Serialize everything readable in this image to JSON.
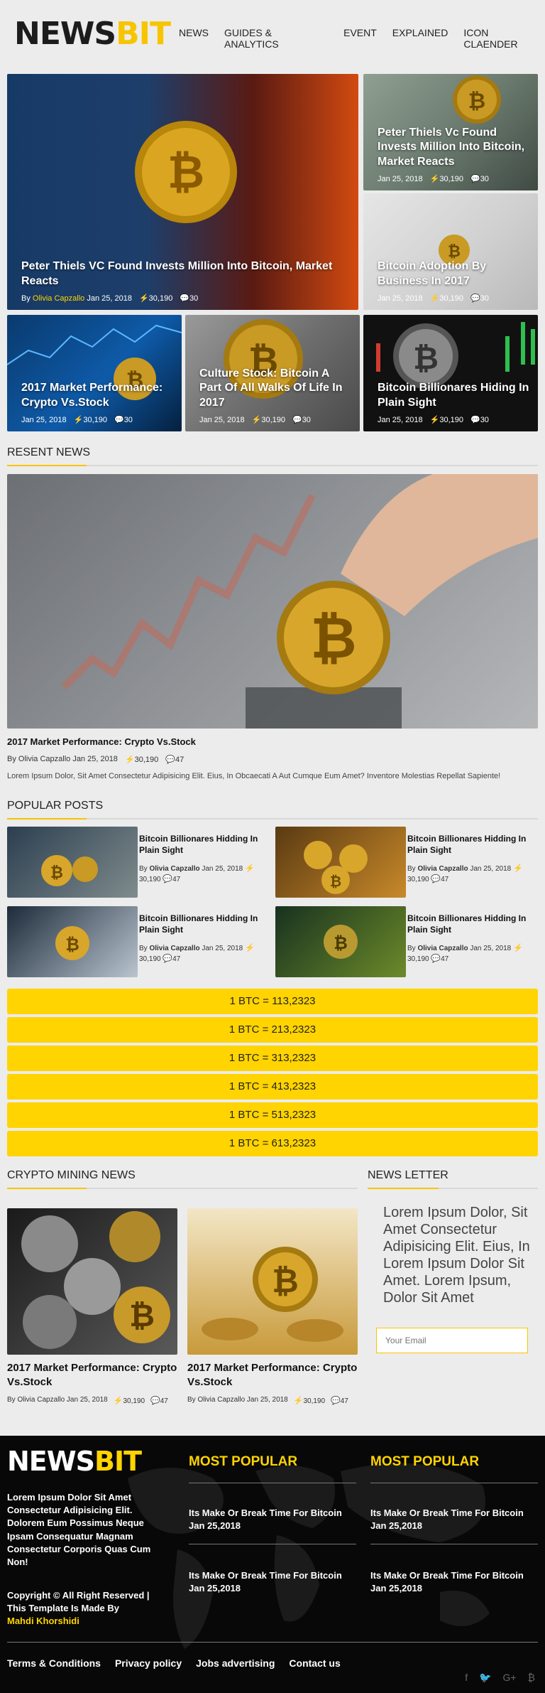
{
  "header": {
    "logo_a": "NEWS",
    "logo_b": "BIT",
    "nav": [
      "NEWS",
      "GUIDES & ANALYTICS",
      "EVENT",
      "EXPLAINED",
      "ICON CLAENDER"
    ]
  },
  "hero": {
    "main": {
      "title": "Peter Thiels VC Found Invests Million Into Bitcoin, Market Reacts",
      "by": "By",
      "author": "Olivia Capzallo",
      "date": "Jan 25, 2018",
      "views": "30,190",
      "comments": "30"
    },
    "side1": {
      "title": "Peter Thiels Vc Found Invests Million Into Bitcoin, Market Reacts",
      "date": "Jan 25, 2018",
      "views": "30,190",
      "comments": "30"
    },
    "side2": {
      "title": "Bitcoin Adoption By Business In 2017",
      "date": "Jan 25, 2018",
      "views": "30,190",
      "comments": "30"
    },
    "bottom1": {
      "title": "2017 Market Performance: Crypto Vs.Stock",
      "date": "Jan 25, 2018",
      "views": "30,190",
      "comments": "30"
    },
    "bottom2": {
      "title": "Culture Stock: Bitcoin A Part Of All Walks Of Life In 2017",
      "date": "Jan 25, 2018",
      "views": "30,190",
      "comments": "30"
    },
    "bottom3": {
      "title": "Bitcoin Billionares Hiding In Plain Sight",
      "date": "Jan 25, 2018",
      "views": "30,190",
      "comments": "30"
    }
  },
  "recent": {
    "heading": "RESENT NEWS",
    "title": "2017 Market Performance: Crypto Vs.Stock",
    "meta": "By Olivia Capzallo Jan 25, 2018",
    "views": "30,190",
    "comments": "47",
    "excerpt": "Lorem Ipsum Dolor, Sit Amet Consectetur Adipisicing Elit. Eius, In Obcaecati A Aut Cumque Eum Amet? Inventore Molestias Repellat Sapiente!"
  },
  "popular": {
    "heading": "POPULAR POSTS",
    "items": [
      {
        "title": "Bitcoin Billionares Hidding In Plain Sight",
        "by": "By",
        "author": "Olivia Capzallo",
        "date": "Jan 25, 2018",
        "views": "30,190",
        "comments": "47"
      },
      {
        "title": "Bitcoin Billionares Hidding In Plain Sight",
        "by": "By",
        "author": "Olivia Capzallo",
        "date": "Jan 25, 2018",
        "views": "30,190",
        "comments": "47"
      },
      {
        "title": "Bitcoin Billionares Hidding In Plain Sight",
        "by": "By",
        "author": "Olivia Capzallo",
        "date": "Jan 25, 2018",
        "views": "30,190",
        "comments": "47"
      },
      {
        "title": "Bitcoin Billionares Hidding In Plain Sight",
        "by": "By",
        "author": "Olivia Capzallo",
        "date": "Jan 25, 2018",
        "views": "30,190",
        "comments": "47"
      }
    ]
  },
  "btc_rates": [
    "1 BTC = 113,2323",
    "1 BTC = 213,2323",
    "1 BTC = 313,2323",
    "1 BTC = 413,2323",
    "1 BTC = 513,2323",
    "1 BTC = 613,2323"
  ],
  "mining": {
    "heading": "CRYPTO MINING NEWS",
    "items": [
      {
        "title": "2017 Market Performance: Crypto Vs.Stock",
        "meta": "By Olivia Capzallo Jan 25, 2018",
        "views": "30,190",
        "comments": "47"
      },
      {
        "title": "2017 Market Performance: Crypto Vs.Stock",
        "meta": "By Olivia Capzallo Jan 25, 2018",
        "views": "30,190",
        "comments": "47"
      }
    ]
  },
  "newsletter": {
    "heading": "NEWS LETTER",
    "text": "Lorem Ipsum Dolor, Sit Amet Consectetur Adipisicing Elit. Eius, In Lorem Ipsum Dolor Sit Amet. Lorem Ipsum, Dolor Sit Amet",
    "placeholder": "Your Email"
  },
  "footer": {
    "logo_a": "NEWS",
    "logo_b": "BIT",
    "about": "Lorem Ipsum Dolor Sit Amet Consectetur Adipisicing Elit. Dolorem Eum Possimus Neque Ipsam Consequatur Magnam Consectetur Corporis Quas Cum Non!",
    "copyright": "Copyright © All Right Reserved | This Template Is Made By",
    "author": "Mahdi Khorshidi",
    "col1_heading": "MOST POPULAR",
    "col2_heading": "MOST POPULAR",
    "col1_items": [
      "Its Make Or Break Time For Bitcoin Jan 25,2018",
      "Its Make Or Break Time For Bitcoin Jan 25,2018"
    ],
    "col2_items": [
      "Its Make Or Break Time For Bitcoin Jan 25,2018",
      "Its Make Or Break Time For Bitcoin Jan 25,2018"
    ],
    "links": [
      "Terms & Conditions",
      "Privacy policy",
      "Jobs advertising",
      "Contact us"
    ],
    "social": [
      "facebook-icon",
      "twitter-icon",
      "google-plus-icon",
      "bitcoin-icon"
    ]
  },
  "colors": {
    "accent": "#ffd400",
    "dark": "#080808",
    "bg": "#ececec"
  }
}
